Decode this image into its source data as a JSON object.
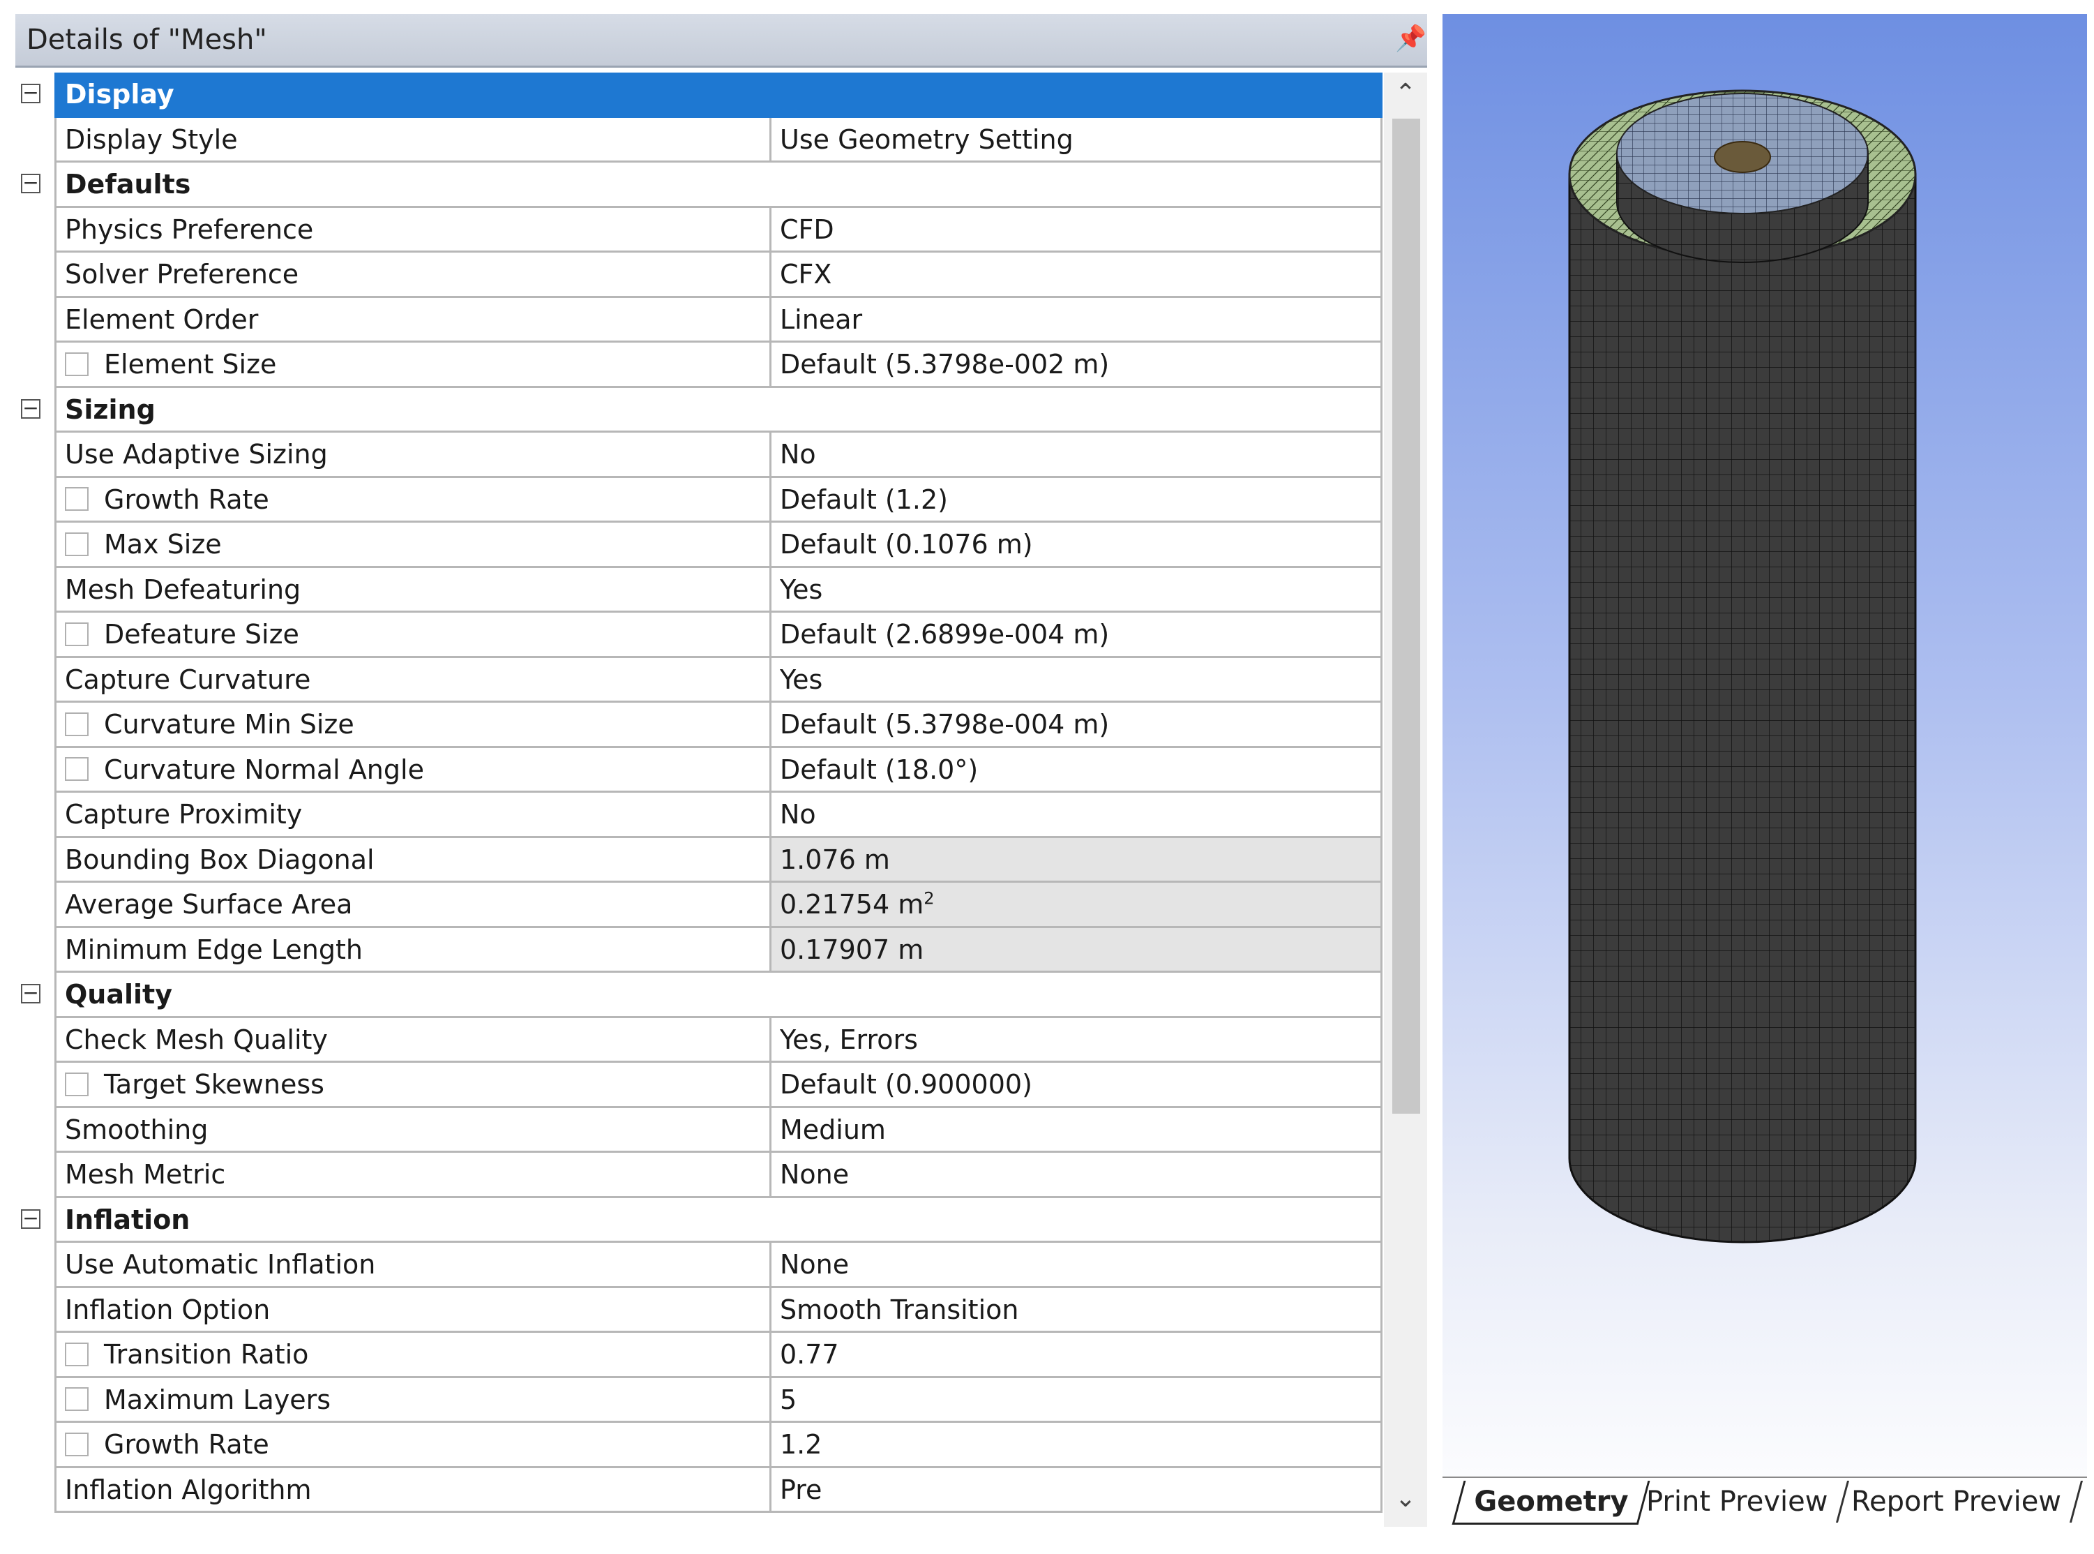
{
  "panel": {
    "title": "Details of \"Mesh\"",
    "pin_icon": "pin-icon"
  },
  "rows": [
    {
      "type": "category",
      "name": "Display",
      "selected": true
    },
    {
      "type": "prop",
      "name": "Display Style",
      "value": "Use Geometry Setting"
    },
    {
      "type": "category",
      "name": "Defaults"
    },
    {
      "type": "prop",
      "name": "Physics Preference",
      "value": "CFD"
    },
    {
      "type": "prop",
      "name": "Solver Preference",
      "value": "CFX"
    },
    {
      "type": "prop",
      "name": "Element Order",
      "value": "Linear"
    },
    {
      "type": "prop",
      "name": "Element Size",
      "value": "Default (5.3798e-002 m)",
      "checkbox": true
    },
    {
      "type": "category",
      "name": "Sizing"
    },
    {
      "type": "prop",
      "name": "Use Adaptive Sizing",
      "value": "No"
    },
    {
      "type": "prop",
      "name": "Growth Rate",
      "value": "Default (1.2)",
      "checkbox": true
    },
    {
      "type": "prop",
      "name": "Max Size",
      "value": "Default (0.1076 m)",
      "checkbox": true
    },
    {
      "type": "prop",
      "name": "Mesh Defeaturing",
      "value": "Yes"
    },
    {
      "type": "prop",
      "name": "Defeature Size",
      "value": "Default (2.6899e-004 m)",
      "checkbox": true
    },
    {
      "type": "prop",
      "name": "Capture Curvature",
      "value": "Yes"
    },
    {
      "type": "prop",
      "name": "Curvature Min Size",
      "value": "Default (5.3798e-004 m)",
      "checkbox": true
    },
    {
      "type": "prop",
      "name": "Curvature Normal Angle",
      "value": "Default (18.0°)",
      "checkbox": true
    },
    {
      "type": "prop",
      "name": "Capture Proximity",
      "value": "No"
    },
    {
      "type": "prop",
      "name": "Bounding Box Diagonal",
      "value": "1.076 m",
      "readonly": true
    },
    {
      "type": "prop",
      "name": "Average Surface Area",
      "value": "0.21754 m",
      "sup": "2",
      "readonly": true
    },
    {
      "type": "prop",
      "name": "Minimum Edge Length",
      "value": "0.17907 m",
      "readonly": true
    },
    {
      "type": "category",
      "name": "Quality"
    },
    {
      "type": "prop",
      "name": "Check Mesh Quality",
      "value": "Yes, Errors"
    },
    {
      "type": "prop",
      "name": "Target Skewness",
      "value": "Default (0.900000)",
      "checkbox": true
    },
    {
      "type": "prop",
      "name": "Smoothing",
      "value": "Medium"
    },
    {
      "type": "prop",
      "name": "Mesh Metric",
      "value": "None"
    },
    {
      "type": "category",
      "name": "Inflation"
    },
    {
      "type": "prop",
      "name": "Use Automatic Inflation",
      "value": "None"
    },
    {
      "type": "prop",
      "name": "Inflation Option",
      "value": "Smooth Transition"
    },
    {
      "type": "prop",
      "name": "Transition Ratio",
      "value": "0.77",
      "checkbox": true
    },
    {
      "type": "prop",
      "name": "Maximum Layers",
      "value": "5",
      "checkbox": true
    },
    {
      "type": "prop",
      "name": "Growth Rate",
      "value": "1.2",
      "checkbox": true
    },
    {
      "type": "prop",
      "name": "Inflation Algorithm",
      "value": "Pre"
    }
  ],
  "scrollbar": {
    "up_icon": "chevron-up-icon",
    "down_icon": "chevron-down-icon"
  },
  "viewport": {
    "model": "cylinder-mesh",
    "colors": {
      "mesh_side": "#3c3c3c",
      "ring": "#a8c090",
      "top_cap": "#8fa0bc",
      "background_top": "#6e8fe2"
    }
  },
  "tabs": [
    {
      "label": "Geometry",
      "active": true
    },
    {
      "label": "Print Preview",
      "active": false
    },
    {
      "label": "Report Preview",
      "active": false
    }
  ]
}
